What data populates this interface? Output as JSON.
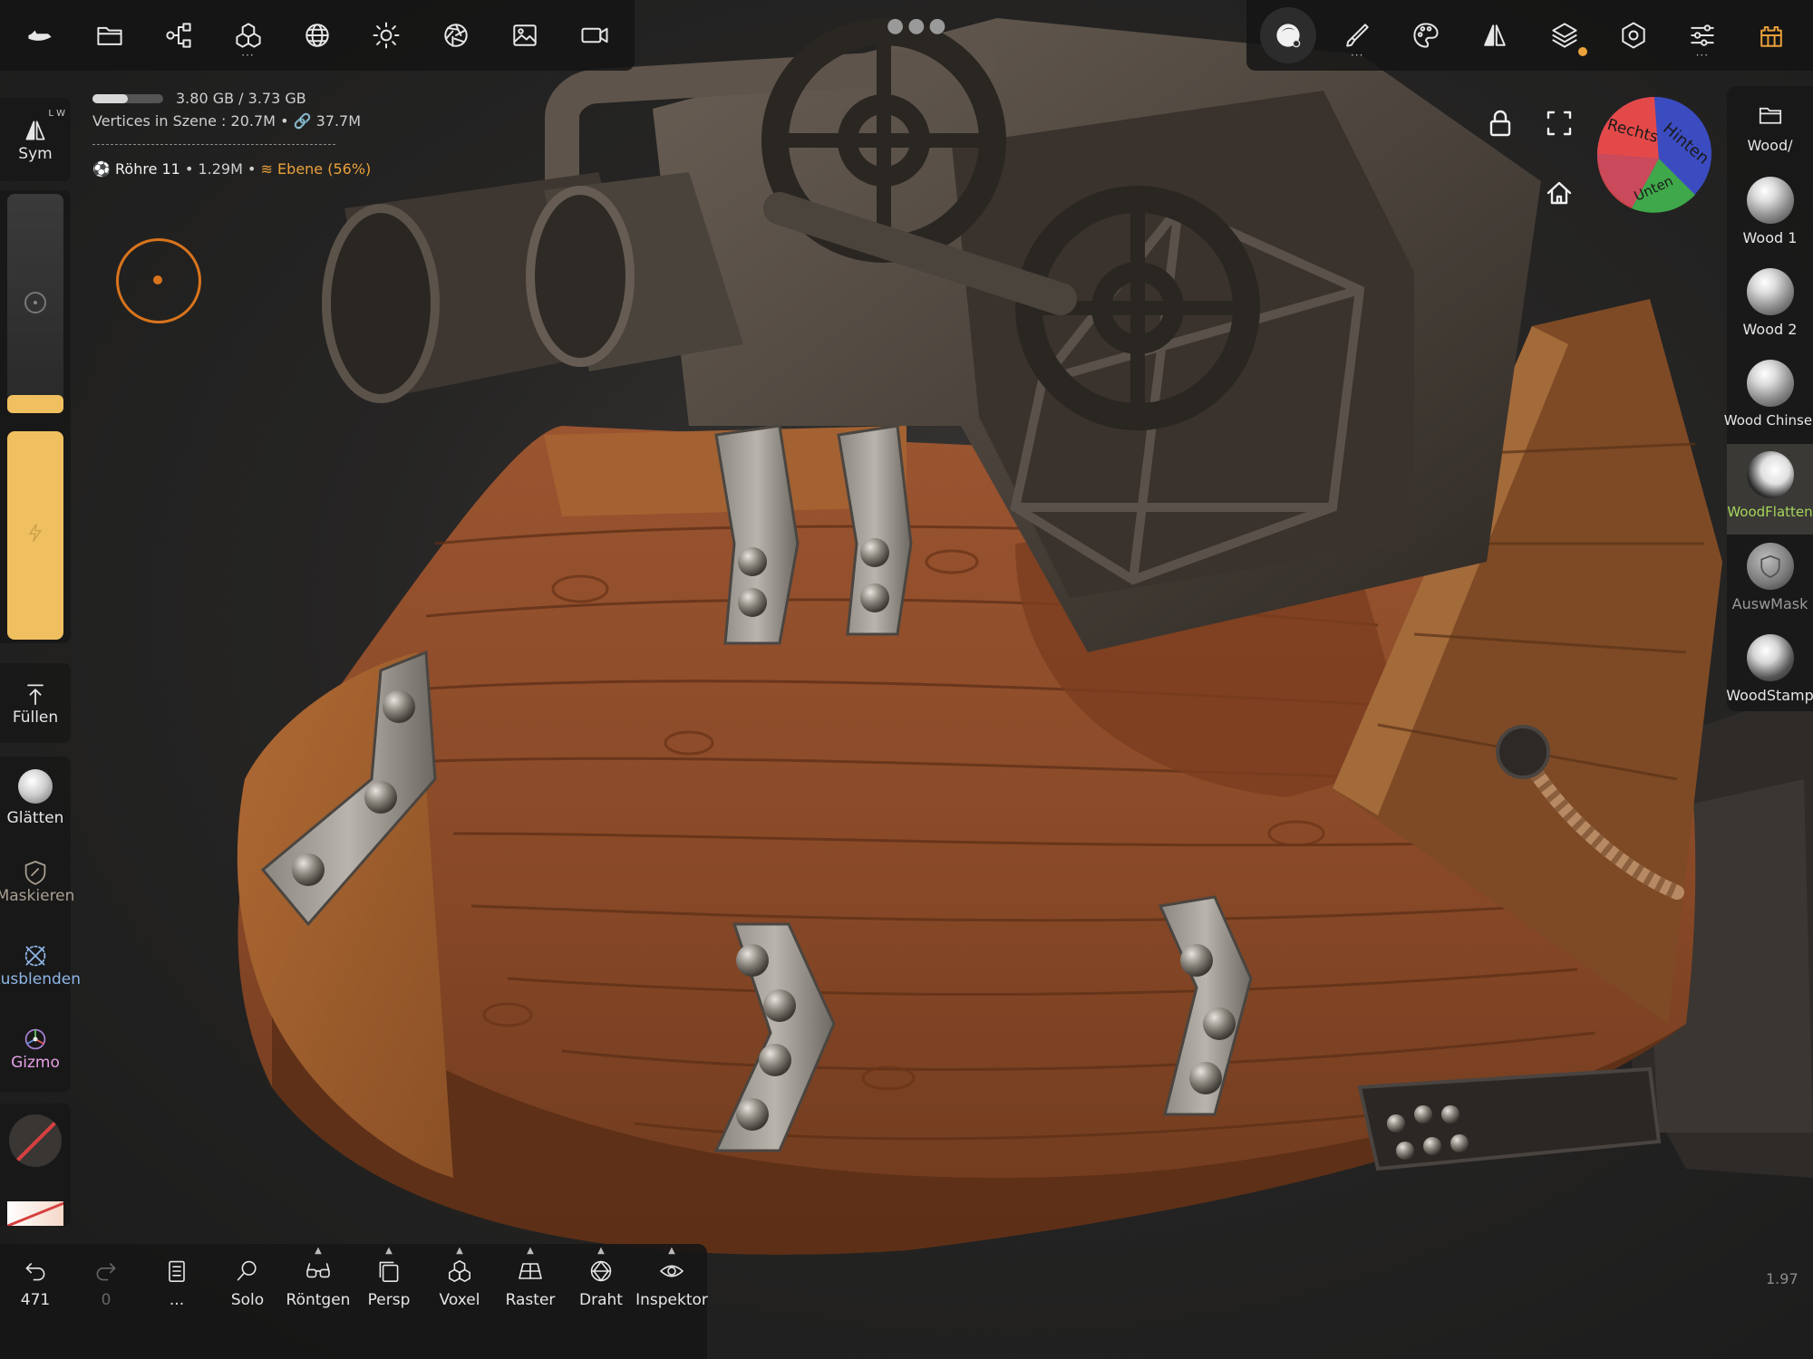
{
  "colors": {
    "accent": "#e9a13b",
    "brush_ring": "#d9741c",
    "selected_brush": "#a6d65a",
    "panel": "#181818",
    "wood": "#9a5430"
  },
  "top_toolbar_left": [
    "boat-logo-icon",
    "folder-icon",
    "share-icon",
    "cubes-icon",
    "sphere-grid-icon",
    "sun-icon",
    "aperture-icon",
    "image-icon",
    "video-icon"
  ],
  "top_toolbar_right": [
    "matcap-icon",
    "brush-icon",
    "palette-icon",
    "symmetry-icon",
    "layers-icon",
    "settings-icon",
    "sliders-icon",
    "castle-icon"
  ],
  "info": {
    "memory": "3.80 GB / 3.73 GB",
    "memory_fill": 0.5,
    "vertices_label": "Vertices in Szene :",
    "vertices_value": "20.7M",
    "link_value": "37.7M",
    "object_name": "Röhre 11",
    "object_verts": "1.29M",
    "layer": "Ebene (56%)"
  },
  "left_panel": {
    "sym_label": "Sym",
    "sym_badge": "L W",
    "fill_label": "Füllen",
    "smooth_label": "Glätten",
    "mask_label": "Maskieren",
    "hide_label": "Ausblenden",
    "gizmo_label": "Gizmo"
  },
  "right_panel": {
    "folder_label": "Wood/",
    "brushes": [
      {
        "label": "Wood 1"
      },
      {
        "label": "Wood 2"
      },
      {
        "label": "Wood Chinsel"
      },
      {
        "label": "WoodFlatten"
      },
      {
        "label": "AuswMask"
      },
      {
        "label": "WoodStamp"
      }
    ]
  },
  "view_cube": {
    "faces": [
      "Rechts",
      "Hinten",
      "Unten"
    ]
  },
  "bottom_toolbar": [
    {
      "label": "471",
      "icon": "undo-icon"
    },
    {
      "label": "0",
      "icon": "redo-icon"
    },
    {
      "label": "...",
      "icon": "notebook-icon"
    },
    {
      "label": "Solo",
      "icon": "search-icon"
    },
    {
      "label": "Röntgen",
      "icon": "glasses-icon"
    },
    {
      "label": "Persp",
      "icon": "persp-icon"
    },
    {
      "label": "Voxel",
      "icon": "voxel-icon"
    },
    {
      "label": "Raster",
      "icon": "grid-icon"
    },
    {
      "label": "Draht",
      "icon": "wireframe-icon"
    },
    {
      "label": "Inspektor",
      "icon": "eye-icon"
    }
  ],
  "version": "1.97"
}
